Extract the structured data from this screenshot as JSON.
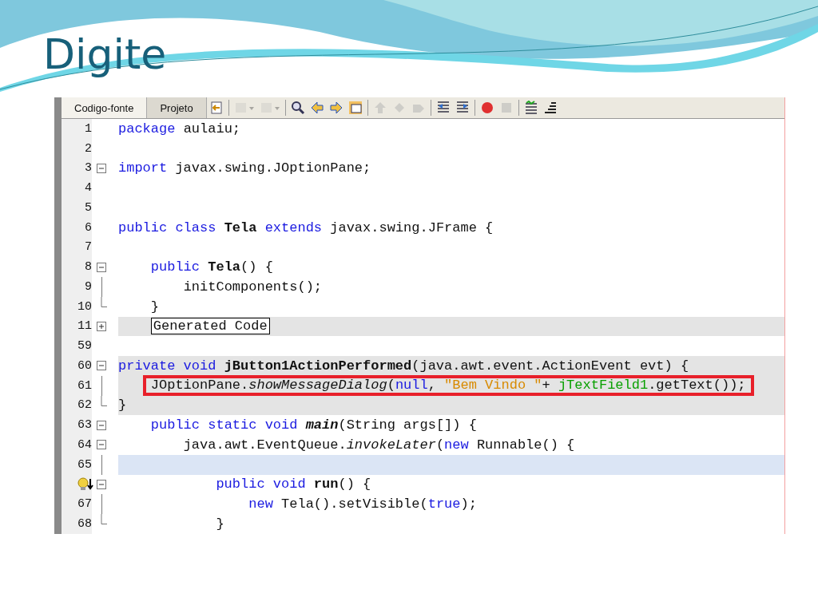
{
  "slide": {
    "title": "Digite"
  },
  "editor": {
    "tabs": [
      {
        "label": "Codigo-fonte",
        "selected": true
      },
      {
        "label": "Projeto",
        "selected": false
      }
    ],
    "toolbar": [
      {
        "kind": "history",
        "disabled": false,
        "dropdown": false
      },
      {
        "kind": "separator"
      },
      {
        "kind": "back",
        "disabled": true,
        "dropdown": true
      },
      {
        "kind": "forward",
        "disabled": true,
        "dropdown": true
      },
      {
        "kind": "separator"
      },
      {
        "kind": "find",
        "disabled": false,
        "dropdown": false
      },
      {
        "kind": "arrow-left",
        "disabled": false,
        "dropdown": false
      },
      {
        "kind": "arrow-right",
        "disabled": false,
        "dropdown": false
      },
      {
        "kind": "window",
        "disabled": false,
        "dropdown": false
      },
      {
        "kind": "separator"
      },
      {
        "kind": "arrow-up",
        "disabled": true,
        "dropdown": false
      },
      {
        "kind": "diamond",
        "disabled": true,
        "dropdown": false
      },
      {
        "kind": "tag",
        "disabled": true,
        "dropdown": false
      },
      {
        "kind": "separator"
      },
      {
        "kind": "shift-left",
        "disabled": false,
        "dropdown": false
      },
      {
        "kind": "shift-right",
        "disabled": false,
        "dropdown": false
      },
      {
        "kind": "separator"
      },
      {
        "kind": "record",
        "disabled": false,
        "dropdown": false
      },
      {
        "kind": "stop",
        "disabled": true,
        "dropdown": false
      },
      {
        "kind": "separator"
      },
      {
        "kind": "chart",
        "disabled": false,
        "dropdown": false
      },
      {
        "kind": "bars",
        "disabled": false,
        "dropdown": false
      }
    ],
    "lines": [
      {
        "number": "1",
        "kind": "plain",
        "highlighted": false,
        "current": false,
        "boxed": false,
        "warning": false,
        "tokens": [
          {
            "kind": "kw",
            "text": "package "
          },
          {
            "kind": "plain",
            "text": "aulaiu;"
          }
        ]
      },
      {
        "number": "2",
        "kind": "plain",
        "highlighted": false,
        "current": false,
        "boxed": false,
        "warning": false
      },
      {
        "number": "3",
        "kind": "fold-start",
        "highlighted": false,
        "current": false,
        "boxed": false,
        "warning": false,
        "tokens": [
          {
            "kind": "kw",
            "text": "import "
          },
          {
            "kind": "plain",
            "text": "javax.swing.JOptionPane;"
          }
        ]
      },
      {
        "number": "4",
        "kind": "plain",
        "highlighted": false,
        "current": false,
        "boxed": false,
        "warning": false
      },
      {
        "number": "5",
        "kind": "plain",
        "highlighted": false,
        "current": false,
        "boxed": false,
        "warning": false
      },
      {
        "number": "6",
        "kind": "plain",
        "highlighted": false,
        "current": false,
        "boxed": false,
        "warning": false,
        "tokens": [
          {
            "kind": "kw",
            "text": "public class "
          },
          {
            "kind": "bold",
            "text": "Tela"
          },
          {
            "kind": "kw",
            "text": " extends "
          },
          {
            "kind": "plain",
            "text": "javax.swing.JFrame {"
          }
        ]
      },
      {
        "number": "7",
        "kind": "plain",
        "highlighted": false,
        "current": false,
        "boxed": false,
        "warning": false
      },
      {
        "number": "8",
        "kind": "fold-start",
        "highlighted": false,
        "current": false,
        "boxed": false,
        "warning": false,
        "tokens": [
          {
            "kind": "kw",
            "text": "    public "
          },
          {
            "kind": "bold",
            "text": "Tela"
          },
          {
            "kind": "plain",
            "text": "() {"
          }
        ]
      },
      {
        "number": "9",
        "kind": "fold-body",
        "highlighted": false,
        "current": false,
        "boxed": false,
        "warning": false,
        "tokens": [
          {
            "kind": "plain",
            "text": "        initComponents();"
          }
        ]
      },
      {
        "number": "10",
        "kind": "fold-end",
        "highlighted": false,
        "current": false,
        "boxed": false,
        "warning": false,
        "tokens": [
          {
            "kind": "plain",
            "text": "    }"
          }
        ]
      },
      {
        "number": "11",
        "kind": "fold-collapsed",
        "highlighted": true,
        "current": false,
        "boxed": false,
        "warning": false,
        "tokens": [
          {
            "kind": "folded",
            "text": "    Generated Code"
          }
        ]
      },
      {
        "number": "59",
        "kind": "plain",
        "highlighted": false,
        "current": false,
        "boxed": false,
        "warning": false
      },
      {
        "number": "60",
        "kind": "fold-start",
        "highlighted": true,
        "current": false,
        "boxed": false,
        "warning": false,
        "tokens": [
          {
            "kind": "kw",
            "text": "private void "
          },
          {
            "kind": "bold",
            "text": "jButton1ActionPerformed"
          },
          {
            "kind": "plain",
            "text": "(java.awt.event.ActionEvent evt) {"
          }
        ]
      },
      {
        "number": "61",
        "kind": "fold-body",
        "highlighted": true,
        "current": false,
        "boxed": true,
        "warning": false,
        "tokens": [
          {
            "kind": "plain",
            "text": "    JOptionPane."
          },
          {
            "kind": "italic",
            "text": "showMessageDialog"
          },
          {
            "kind": "plain",
            "text": "("
          },
          {
            "kind": "kw",
            "text": "null"
          },
          {
            "kind": "plain",
            "text": ", "
          },
          {
            "kind": "string",
            "text": "\"Bem Vindo \""
          },
          {
            "kind": "plain",
            "text": "+ "
          },
          {
            "kind": "field",
            "text": "jTextField1"
          },
          {
            "kind": "plain",
            "text": ".getText());"
          }
        ]
      },
      {
        "number": "62",
        "kind": "fold-end",
        "highlighted": true,
        "current": false,
        "boxed": false,
        "warning": false,
        "tokens": [
          {
            "kind": "plain",
            "text": "}"
          }
        ]
      },
      {
        "number": "63",
        "kind": "fold-start",
        "highlighted": false,
        "current": false,
        "boxed": false,
        "warning": false,
        "tokens": [
          {
            "kind": "kw",
            "text": "    public static void "
          },
          {
            "kind": "bolditalic",
            "text": "main"
          },
          {
            "kind": "plain",
            "text": "(String args[]) {"
          }
        ]
      },
      {
        "number": "64",
        "kind": "fold-start",
        "highlighted": false,
        "current": false,
        "boxed": false,
        "warning": false,
        "tokens": [
          {
            "kind": "plain",
            "text": "        java.awt.EventQueue."
          },
          {
            "kind": "italic",
            "text": "invokeLater"
          },
          {
            "kind": "plain",
            "text": "("
          },
          {
            "kind": "kw",
            "text": "new"
          },
          {
            "kind": "plain",
            "text": " Runnable() {"
          }
        ]
      },
      {
        "number": "65",
        "kind": "fold-body",
        "highlighted": false,
        "current": true,
        "boxed": false,
        "warning": false
      },
      {
        "warning": true,
        "kind": "fold-start",
        "highlighted": false,
        "current": false,
        "boxed": false,
        "tokens": [
          {
            "kind": "kw",
            "text": "            public void "
          },
          {
            "kind": "bold",
            "text": "run"
          },
          {
            "kind": "plain",
            "text": "() {"
          }
        ]
      },
      {
        "number": "67",
        "kind": "fold-body",
        "highlighted": false,
        "current": false,
        "boxed": false,
        "warning": false,
        "tokens": [
          {
            "kind": "kw",
            "text": "                new"
          },
          {
            "kind": "plain",
            "text": " Tela().setVisible("
          },
          {
            "kind": "kw",
            "text": "true"
          },
          {
            "kind": "plain",
            "text": ");"
          }
        ]
      },
      {
        "number": "68",
        "kind": "fold-end",
        "highlighted": false,
        "current": false,
        "boxed": false,
        "warning": false,
        "tokens": [
          {
            "kind": "plain",
            "text": "            }"
          }
        ]
      }
    ]
  }
}
